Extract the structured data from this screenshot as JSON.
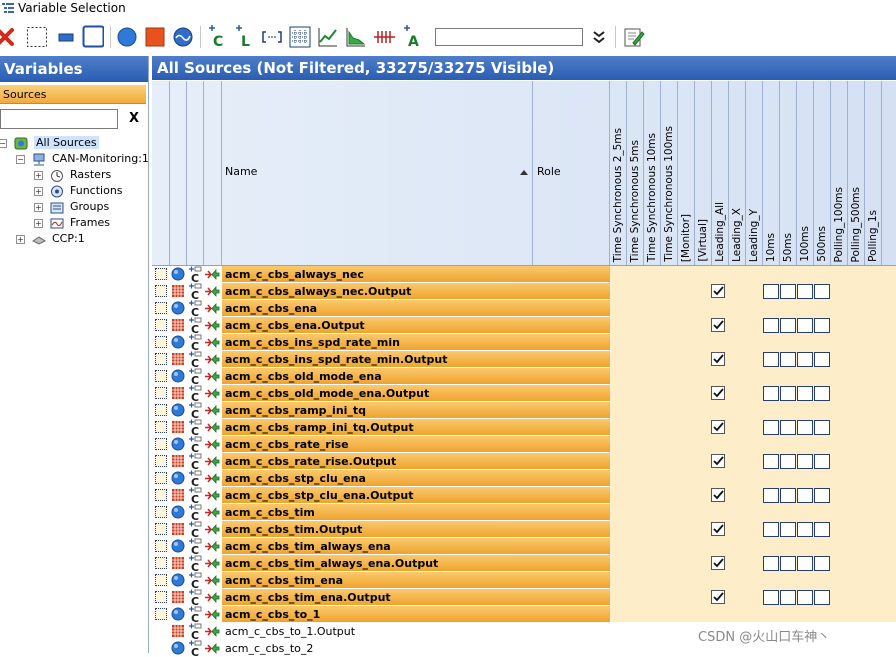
{
  "window": {
    "title": "Variable Selection"
  },
  "toolbar": {
    "search_value": "",
    "icons": [
      "delete-icon",
      "select-dotted-icon",
      "rect-blue-icon",
      "rect-outline-icon",
      "blue-circle-icon",
      "red-square-icon",
      "wave-icon",
      "c-add-icon",
      "l-add-icon",
      "bracket-icon",
      "grid-icon",
      "line-chart-icon",
      "area-chart-icon",
      "pulse-icon",
      "a-add-icon",
      "expand-more-icon",
      "edit-icon"
    ]
  },
  "left": {
    "header": "Variables",
    "tab": "Sources",
    "filter_value": "",
    "filter_clear": "X",
    "tree": [
      {
        "label": "All Sources",
        "expander": "−",
        "icon": "all-sources-icon"
      },
      {
        "label": "CAN-Monitoring:1",
        "expander": "−",
        "icon": "network-icon"
      },
      {
        "label": "Rasters",
        "expander": "+",
        "icon": "raster-icon"
      },
      {
        "label": "Functions",
        "expander": "+",
        "icon": "functions-icon"
      },
      {
        "label": "Groups",
        "expander": "+",
        "icon": "groups-icon"
      },
      {
        "label": "Frames",
        "expander": "+",
        "icon": "frames-icon"
      },
      {
        "label": "CCP:1",
        "expander": "+",
        "icon": "device-icon"
      }
    ]
  },
  "main": {
    "header": "All Sources (Not Filtered, 33275/33275 Visible)",
    "columns": {
      "name": "Name",
      "role": "Role",
      "vertical": [
        "Time Synchronous 2_5ms",
        "Time Synchronous 5ms",
        "Time Synchronous 10ms",
        "Time Synchronous 100ms",
        "[Monitor]",
        "[Virtual]",
        "Leading_All",
        "Leading_X",
        "Leading_Y",
        "10ms",
        "50ms",
        "100ms",
        "500ms",
        "Polling_100ms",
        "Polling_500ms",
        "Polling_1s"
      ]
    },
    "rows": [
      {
        "name": "acm_c_cbs_always_nec",
        "kind": "input",
        "leading_all": false,
        "highlight": true
      },
      {
        "name": "acm_c_cbs_always_nec.Output",
        "kind": "output",
        "leading_all": true,
        "highlight": true
      },
      {
        "name": "acm_c_cbs_ena",
        "kind": "input",
        "leading_all": false,
        "highlight": true
      },
      {
        "name": "acm_c_cbs_ena.Output",
        "kind": "output",
        "leading_all": true,
        "highlight": true
      },
      {
        "name": "acm_c_cbs_ins_spd_rate_min",
        "kind": "input",
        "leading_all": false,
        "highlight": true
      },
      {
        "name": "acm_c_cbs_ins_spd_rate_min.Output",
        "kind": "output",
        "leading_all": true,
        "highlight": true
      },
      {
        "name": "acm_c_cbs_old_mode_ena",
        "kind": "input",
        "leading_all": false,
        "highlight": true
      },
      {
        "name": "acm_c_cbs_old_mode_ena.Output",
        "kind": "output",
        "leading_all": true,
        "highlight": true
      },
      {
        "name": "acm_c_cbs_ramp_ini_tq",
        "kind": "input",
        "leading_all": false,
        "highlight": true
      },
      {
        "name": "acm_c_cbs_ramp_ini_tq.Output",
        "kind": "output",
        "leading_all": true,
        "highlight": true
      },
      {
        "name": "acm_c_cbs_rate_rise",
        "kind": "input",
        "leading_all": false,
        "highlight": true
      },
      {
        "name": "acm_c_cbs_rate_rise.Output",
        "kind": "output",
        "leading_all": true,
        "highlight": true
      },
      {
        "name": "acm_c_cbs_stp_clu_ena",
        "kind": "input",
        "leading_all": false,
        "highlight": true
      },
      {
        "name": "acm_c_cbs_stp_clu_ena.Output",
        "kind": "output",
        "leading_all": true,
        "highlight": true
      },
      {
        "name": "acm_c_cbs_tim",
        "kind": "input",
        "leading_all": false,
        "highlight": true
      },
      {
        "name": "acm_c_cbs_tim.Output",
        "kind": "output",
        "leading_all": true,
        "highlight": true
      },
      {
        "name": "acm_c_cbs_tim_always_ena",
        "kind": "input",
        "leading_all": false,
        "highlight": true
      },
      {
        "name": "acm_c_cbs_tim_always_ena.Output",
        "kind": "output",
        "leading_all": true,
        "highlight": true
      },
      {
        "name": "acm_c_cbs_tim_ena",
        "kind": "input",
        "leading_all": false,
        "highlight": true
      },
      {
        "name": "acm_c_cbs_tim_ena.Output",
        "kind": "output",
        "leading_all": true,
        "highlight": true
      },
      {
        "name": "acm_c_cbs_to_1",
        "kind": "input",
        "leading_all": false,
        "highlight": true
      },
      {
        "name": "acm_c_cbs_to_1.Output",
        "kind": "output",
        "leading_all": false,
        "highlight": false
      },
      {
        "name": "acm_c_cbs_to_2",
        "kind": "input",
        "leading_all": false,
        "highlight": false
      }
    ]
  },
  "watermark": "CSDN @火山口车神丶",
  "colors": {
    "header_blue": "#2a5db3",
    "row_orange": "#f0a32e",
    "grid_cream": "#fdeec9"
  }
}
